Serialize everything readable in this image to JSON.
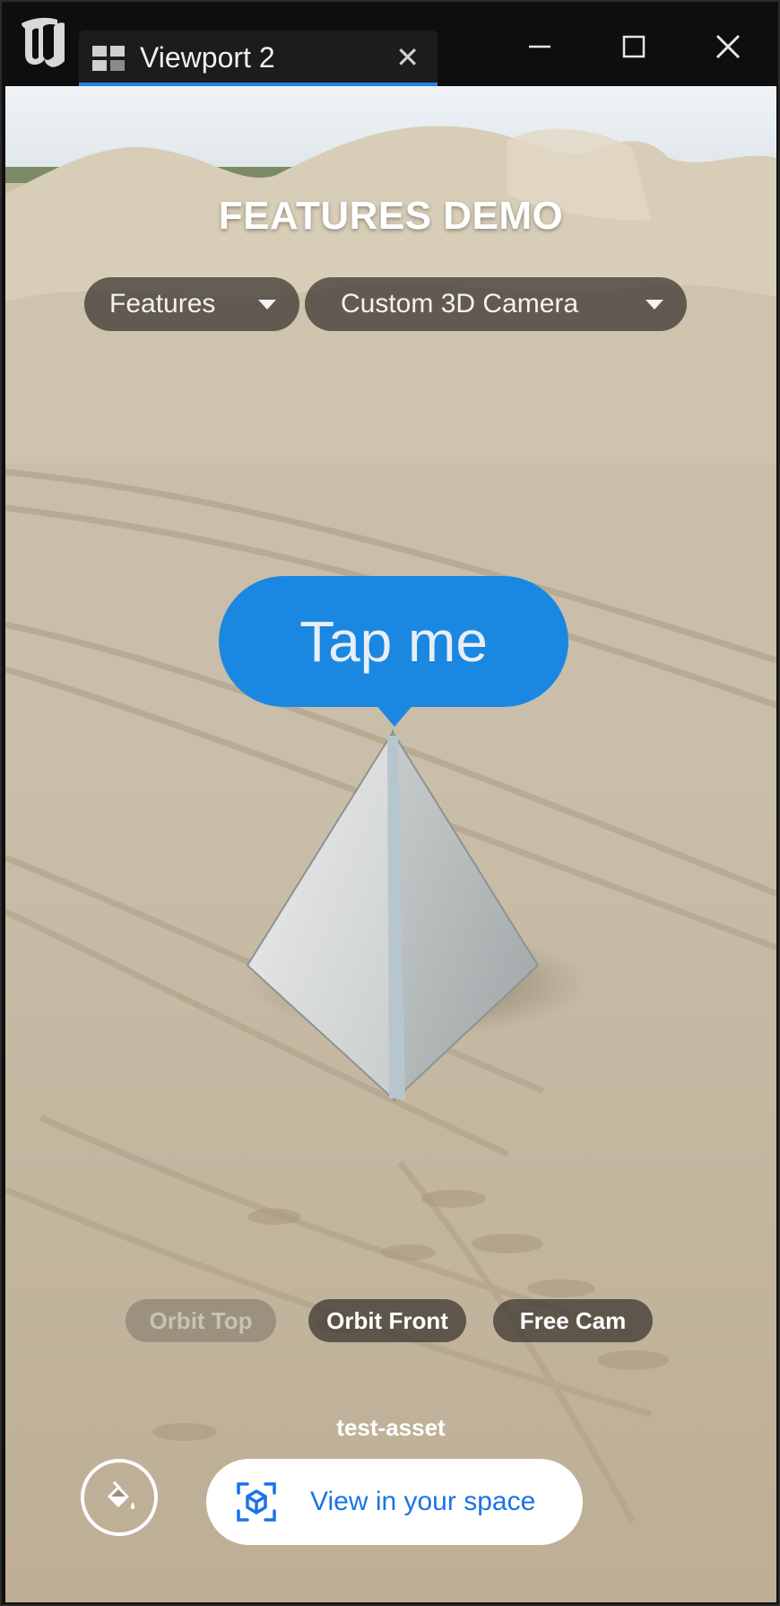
{
  "window": {
    "tab_title": "Viewport 2",
    "tab_close_glyph": "✕",
    "controls": [
      "minimize-icon",
      "maximize-icon",
      "close-icon"
    ]
  },
  "app": {
    "headline": "FEATURES DEMO",
    "category_dropdown": "Features",
    "feature_dropdown": "Custom 3D Camera",
    "hotspot_label": "Tap me",
    "camera_buttons": [
      {
        "label": "Orbit Top",
        "state": "disabled"
      },
      {
        "label": "Orbit Front",
        "state": "enabled"
      },
      {
        "label": "Free Cam",
        "state": "enabled"
      }
    ],
    "asset_name": "test-asset",
    "ar_button_label": "View in your space",
    "paint_icon": "paint-bucket-icon",
    "ar_icon": "view-in-ar-icon"
  },
  "colors": {
    "accent_blue": "#1a88e0",
    "ar_text_blue": "#1a73e8",
    "tab_underline": "#2680e0"
  }
}
